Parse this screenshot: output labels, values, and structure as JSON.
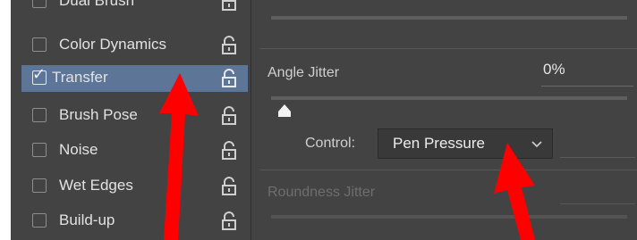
{
  "brush_settings": {
    "items": [
      {
        "label": "Dual Brush",
        "checked": false,
        "active": false
      },
      {
        "label": "Color Dynamics",
        "checked": false,
        "active": false
      },
      {
        "label": "Transfer",
        "checked": true,
        "active": true
      },
      {
        "label": "Brush Pose",
        "checked": false,
        "active": false
      },
      {
        "label": "Noise",
        "checked": false,
        "active": false
      },
      {
        "label": "Wet Edges",
        "checked": false,
        "active": false
      },
      {
        "label": "Build-up",
        "checked": false,
        "active": false
      }
    ]
  },
  "transfer_panel": {
    "angle_jitter_label": "Angle Jitter",
    "angle_jitter_value": "0%",
    "control_label": "Control:",
    "control_selected": "Pen Pressure",
    "roundness_jitter_label": "Roundness Jitter"
  },
  "colors": {
    "panel_bg": "#434343",
    "selected_row": "#5d7596",
    "annotation_arrow": "#ff0000"
  },
  "icons": [
    "checkbox-icon",
    "lock-icon",
    "slider-thumb-icon",
    "chevron-down-icon",
    "red-arrow-icon"
  ]
}
